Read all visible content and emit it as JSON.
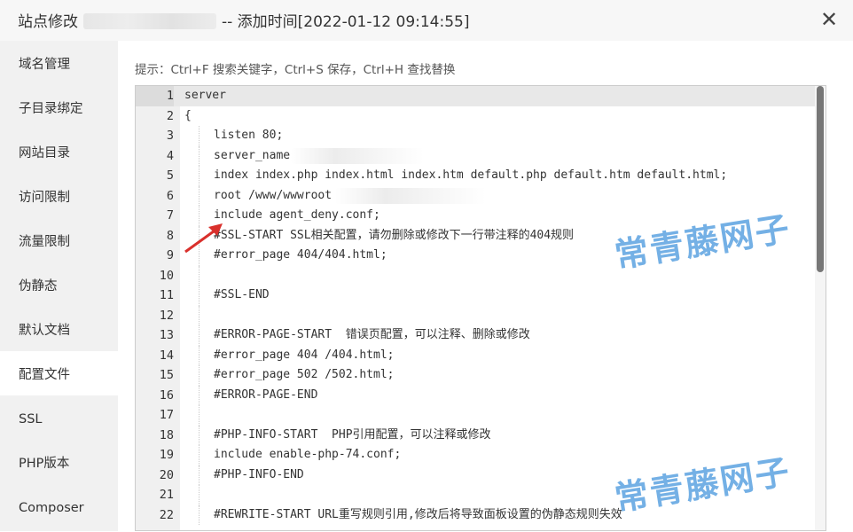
{
  "dialog": {
    "title_prefix": "站点修改",
    "title_suffix": "-- 添加时间[2022-01-12 09:14:55]",
    "close_glyph": "✕"
  },
  "sidebar": {
    "items": [
      {
        "label": "域名管理"
      },
      {
        "label": "子目录绑定"
      },
      {
        "label": "网站目录"
      },
      {
        "label": "访问限制"
      },
      {
        "label": "流量限制"
      },
      {
        "label": "伪静态"
      },
      {
        "label": "默认文档"
      },
      {
        "label": "配置文件",
        "active": true
      },
      {
        "label": "SSL"
      },
      {
        "label": "PHP版本"
      },
      {
        "label": "Composer"
      }
    ]
  },
  "hint": "提示：Ctrl+F 搜索关键字，Ctrl+S 保存，Ctrl+H 查找替换",
  "editor": {
    "current_line": 1,
    "lines": [
      {
        "n": "1",
        "text": "server",
        "indent": false
      },
      {
        "n": "2",
        "text": "{",
        "indent": false
      },
      {
        "n": "3",
        "text": "listen 80;",
        "indent": true
      },
      {
        "n": "4",
        "text": "server_name",
        "indent": true
      },
      {
        "n": "5",
        "text": "index index.php index.html index.htm default.php default.htm default.html;",
        "indent": true
      },
      {
        "n": "6",
        "text": "root /www/wwwroot",
        "indent": true
      },
      {
        "n": "7",
        "text": "include agent_deny.conf;",
        "indent": true
      },
      {
        "n": "8",
        "text": "#SSL-START SSL相关配置，请勿删除或修改下一行带注释的404规则",
        "indent": true
      },
      {
        "n": "9",
        "text": "#error_page 404/404.html;",
        "indent": true
      },
      {
        "n": "10",
        "text": "",
        "indent": true
      },
      {
        "n": "11",
        "text": "#SSL-END",
        "indent": true
      },
      {
        "n": "12",
        "text": "",
        "indent": true
      },
      {
        "n": "13",
        "text": "#ERROR-PAGE-START  错误页配置，可以注释、删除或修改",
        "indent": true
      },
      {
        "n": "14",
        "text": "#error_page 404 /404.html;",
        "indent": true
      },
      {
        "n": "15",
        "text": "#error_page 502 /502.html;",
        "indent": true
      },
      {
        "n": "16",
        "text": "#ERROR-PAGE-END",
        "indent": true
      },
      {
        "n": "17",
        "text": "",
        "indent": true
      },
      {
        "n": "18",
        "text": "#PHP-INFO-START  PHP引用配置，可以注释或修改",
        "indent": true
      },
      {
        "n": "19",
        "text": "include enable-php-74.conf;",
        "indent": true
      },
      {
        "n": "20",
        "text": "#PHP-INFO-END",
        "indent": true
      },
      {
        "n": "21",
        "text": "",
        "indent": true
      },
      {
        "n": "22",
        "text": "#REWRITE-START URL重写规则引用,修改后将导致面板设置的伪静态规则失效",
        "indent": true
      }
    ]
  },
  "watermark": "常青藤网子",
  "colors": {
    "watermark": "#4696dc",
    "arrow": "#d9302c",
    "scroll_thumb": "#777777"
  }
}
